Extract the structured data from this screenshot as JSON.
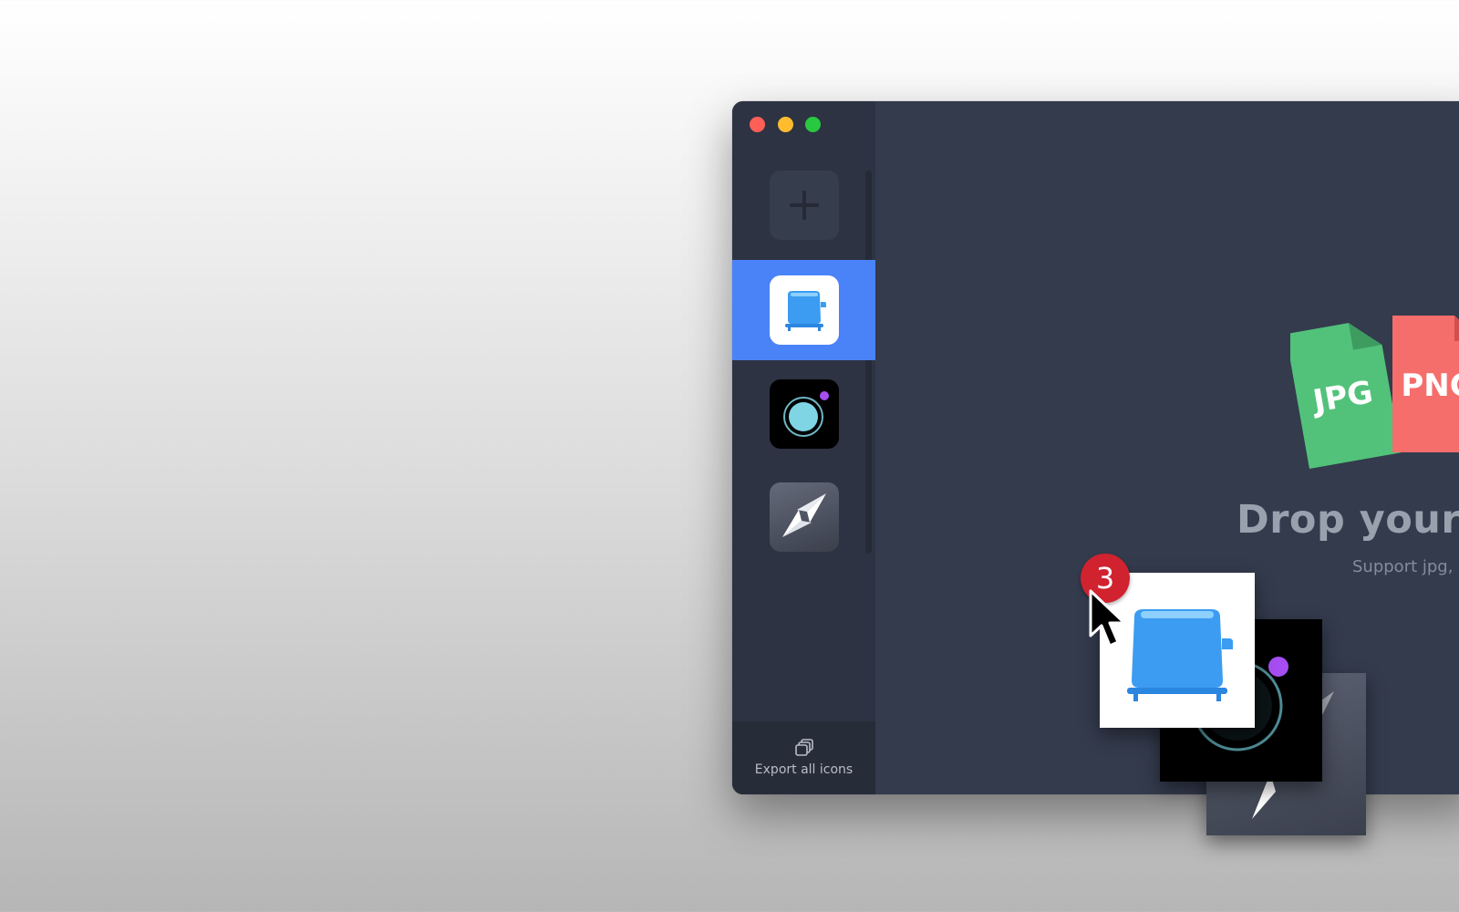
{
  "window": {
    "traffic_lights": [
      "close",
      "minimize",
      "zoom"
    ]
  },
  "sidebar": {
    "add_button_icon": "plus-icon",
    "items": [
      {
        "name": "toaster-app",
        "icon": "toaster-icon",
        "selected": true
      },
      {
        "name": "camera-app",
        "icon": "camera-lens-icon",
        "selected": false
      },
      {
        "name": "navigation-app",
        "icon": "navigation-arrow-icon",
        "selected": false
      }
    ],
    "export": {
      "icon": "copy-stack-icon",
      "label": "Export all icons"
    }
  },
  "main": {
    "file_types": [
      "JPG",
      "PNG"
    ],
    "title": "Drop your files her",
    "subtitle": "Support jpg, png."
  },
  "drag": {
    "count": "3",
    "items": [
      "toaster-app",
      "camera-app",
      "navigation-app"
    ]
  },
  "colors": {
    "accent": "#4a82f7",
    "sidebar": "#2d3342",
    "main": "#343b4d",
    "jpg": "#52c27a",
    "png": "#f56e6c",
    "doc": "#4b8fe0",
    "badge": "#d0232f"
  }
}
